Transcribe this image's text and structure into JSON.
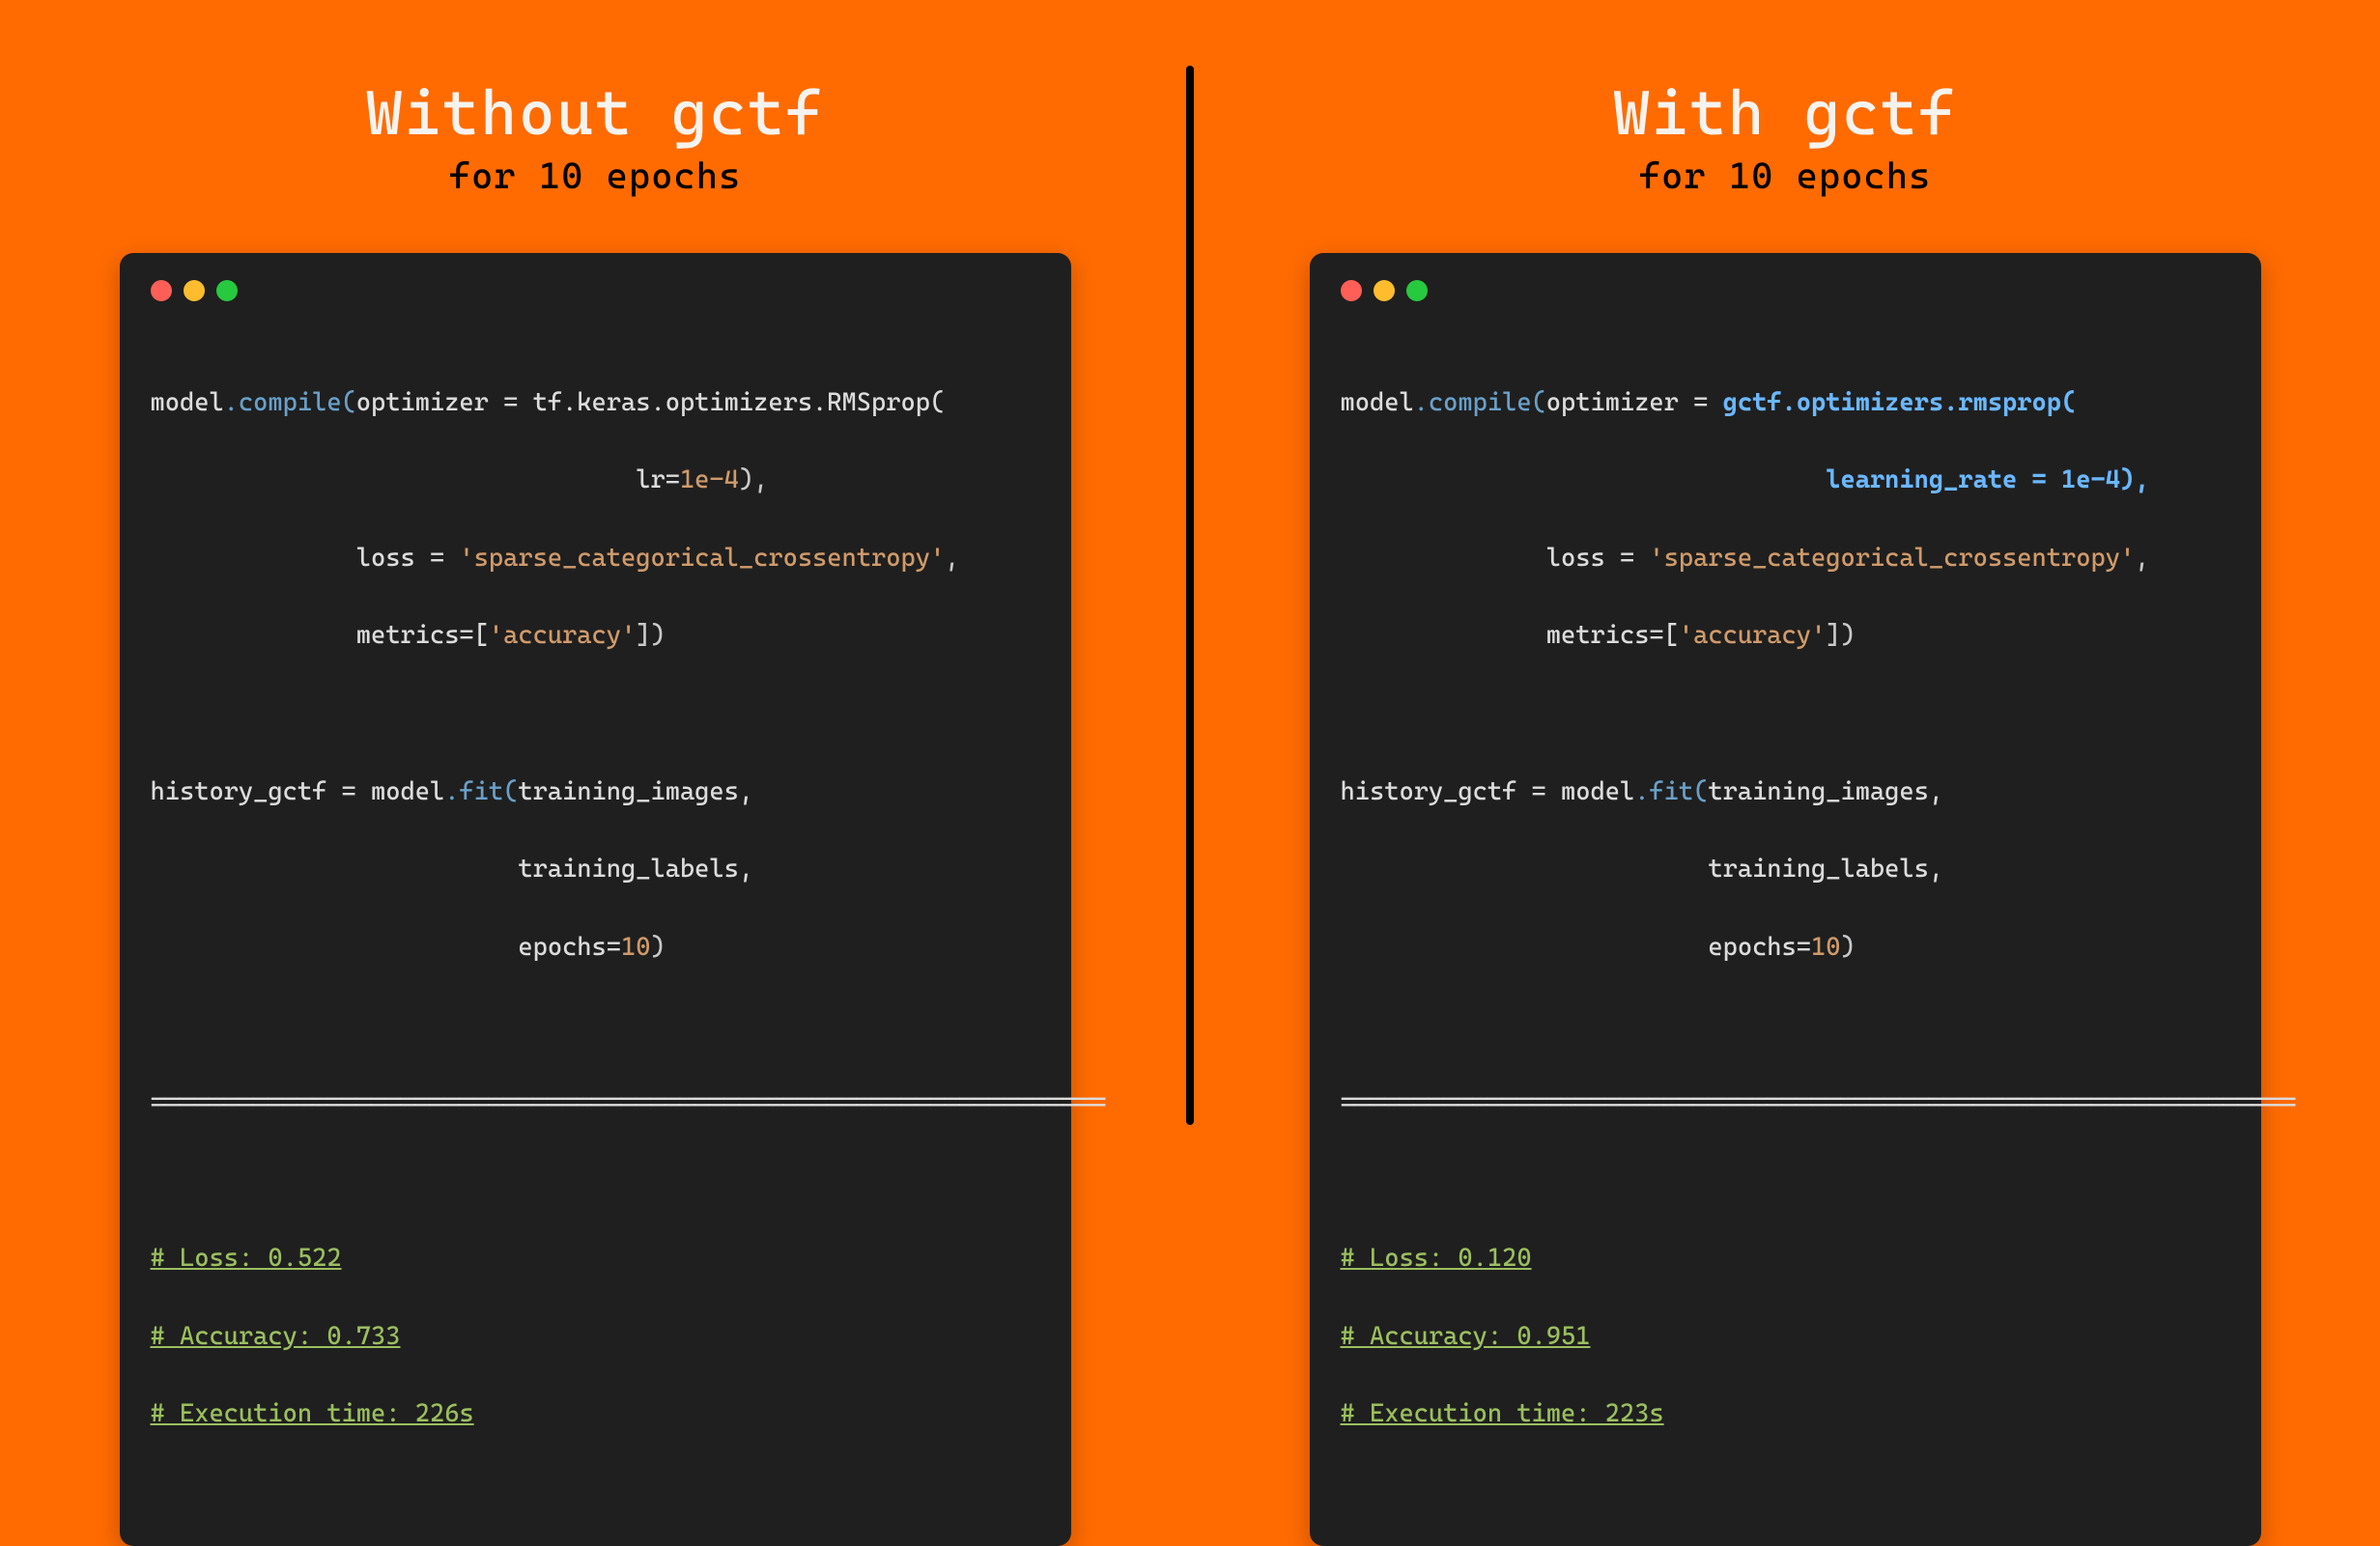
{
  "left": {
    "title": "Without gctf",
    "subtitle": "for 10 epochs",
    "code": {
      "l1a": "model",
      "l1b": ".compile(",
      "l1c": "optimizer = tf.keras.optimizers.RMSprop(",
      "l2": "                                 lr=",
      "l2_num": "1e-4",
      "l2_end": "),",
      "l3a": "              loss = ",
      "l3_str": "'sparse_categorical_crossentropy'",
      "l3b": ",",
      "l4a": "              metrics=[",
      "l4_str": "'accuracy'",
      "l4b": "])",
      "l6a": "history_gctf = model",
      "l6b": ".fit(",
      "l6c": "training_images,",
      "l7": "                         training_labels,",
      "l8a": "                         epochs=",
      "l8_num": "10",
      "l8b": ")",
      "sep": "=================================================================",
      "r1": "# Loss: 0.522",
      "r2": "# Accuracy: 0.733",
      "r3": "# Execution time: 226s"
    }
  },
  "right": {
    "title": "With gctf",
    "subtitle": "for 10 epochs",
    "code": {
      "l1a": "model",
      "l1b": ".compile(",
      "l1c": "optimizer = ",
      "l1_hl": "gctf.optimizers.rmsprop(",
      "l2_pad": "                                 ",
      "l2_hl": "learning_rate = 1e-4),",
      "l3a": "              loss = ",
      "l3_str": "'sparse_categorical_crossentropy'",
      "l3b": ",",
      "l4a": "              metrics=[",
      "l4_str": "'accuracy'",
      "l4b": "])",
      "l6a": "history_gctf = model",
      "l6b": ".fit(",
      "l6c": "training_images,",
      "l7": "                         training_labels,",
      "l8a": "                         epochs=",
      "l8_num": "10",
      "l8b": ")",
      "sep": "=================================================================",
      "r1": "# Loss: 0.120",
      "r2": "# Accuracy: 0.951",
      "r3": "# Execution time: 223s"
    }
  }
}
